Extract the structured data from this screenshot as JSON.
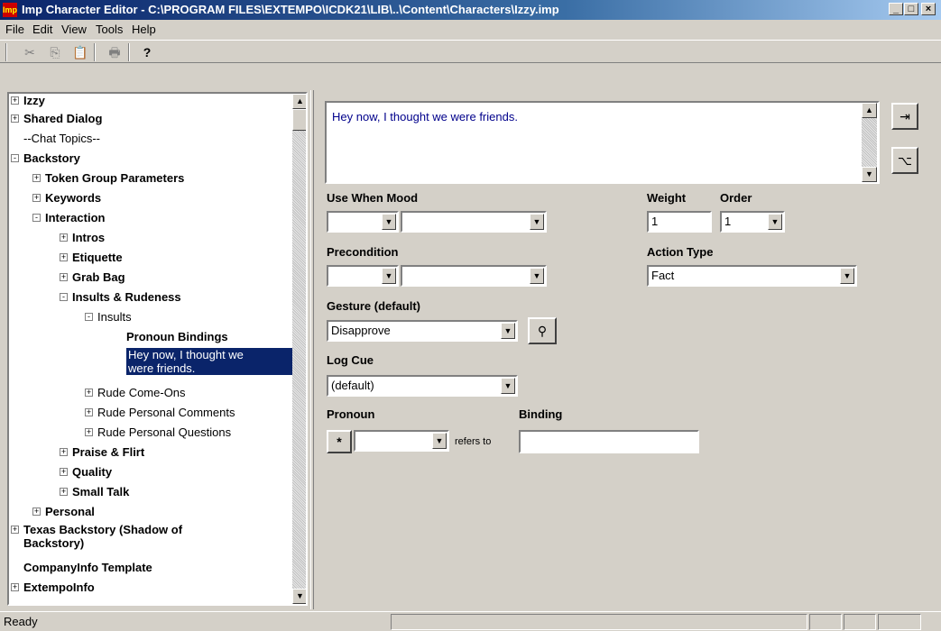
{
  "window": {
    "title": "Imp Character Editor - C:\\PROGRAM FILES\\EXTEMPO\\ICDK21\\LIB\\..\\Content\\Characters\\Izzy.imp",
    "app_icon": "imp-logo",
    "controls": [
      "minimize",
      "maximize",
      "close"
    ]
  },
  "menu": [
    "File",
    "Edit",
    "View",
    "Tools",
    "Help"
  ],
  "toolbar": {
    "icons": [
      "cut-icon",
      "copy-icon",
      "paste-icon",
      "print-icon",
      "help-icon"
    ],
    "glyphs": [
      "✂",
      "⎘",
      "📋",
      "🖶",
      "?"
    ]
  },
  "tree": [
    {
      "label": "Izzy",
      "bold": true,
      "toggle": "+"
    },
    {
      "label": "Shared Dialog",
      "bold": true,
      "toggle": "+"
    },
    {
      "label": "--Chat Topics--",
      "bold": false,
      "toggle": ""
    },
    {
      "label": "Backstory",
      "bold": true,
      "toggle": "-"
    },
    {
      "label": "Token Group Parameters",
      "bold": true,
      "toggle": "+"
    },
    {
      "label": "Keywords",
      "bold": true,
      "toggle": "+"
    },
    {
      "label": "Interaction",
      "bold": true,
      "toggle": "-"
    },
    {
      "label": "Intros",
      "bold": true,
      "toggle": "+"
    },
    {
      "label": "Etiquette",
      "bold": true,
      "toggle": "+"
    },
    {
      "label": "Grab Bag",
      "bold": true,
      "toggle": "+"
    },
    {
      "label": "Insults & Rudeness",
      "bold": true,
      "toggle": "-"
    },
    {
      "label": "Insults",
      "bold": false,
      "toggle": "-"
    },
    {
      "label": "Pronoun Bindings",
      "bold": true,
      "toggle": ""
    },
    {
      "label": "Hey now, I thought we",
      "label2": "were friends.",
      "bold": false,
      "toggle": "",
      "selected": true
    },
    {
      "label": "Rude Come-Ons",
      "bold": false,
      "toggle": "+"
    },
    {
      "label": "Rude Personal Comments",
      "bold": false,
      "toggle": "+"
    },
    {
      "label": "Rude Personal Questions",
      "bold": false,
      "toggle": "+"
    },
    {
      "label": "Praise & Flirt",
      "bold": true,
      "toggle": "+"
    },
    {
      "label": "Quality",
      "bold": true,
      "toggle": "+"
    },
    {
      "label": "Small Talk",
      "bold": true,
      "toggle": "+"
    },
    {
      "label": "Personal",
      "bold": true,
      "toggle": "+"
    },
    {
      "label": "Texas Backstory (Shadow of",
      "label2": "Backstory)",
      "bold": true,
      "toggle": "+"
    },
    {
      "label": "CompanyInfo Template",
      "bold": true,
      "toggle": ""
    },
    {
      "label": "ExtempoInfo",
      "bold": true,
      "toggle": "+"
    }
  ],
  "editor": {
    "utterance": "Hey now, I thought we were friends.",
    "use_when_mood_label": "Use When Mood",
    "weight_label": "Weight",
    "weight_value": "1",
    "order_label": "Order",
    "order_value": "1",
    "precondition_label": "Precondition",
    "action_type_label": "Action Type",
    "action_type_value": "Fact",
    "gesture_label": "Gesture (default)",
    "gesture_value": "Disapprove",
    "log_cue_label": "Log Cue",
    "log_cue_value": "(default)",
    "pronoun_label": "Pronoun",
    "binding_label": "Binding",
    "pronoun_star": "*",
    "refers_to": "refers to",
    "binding_value": ""
  },
  "status": {
    "text": "Ready"
  }
}
